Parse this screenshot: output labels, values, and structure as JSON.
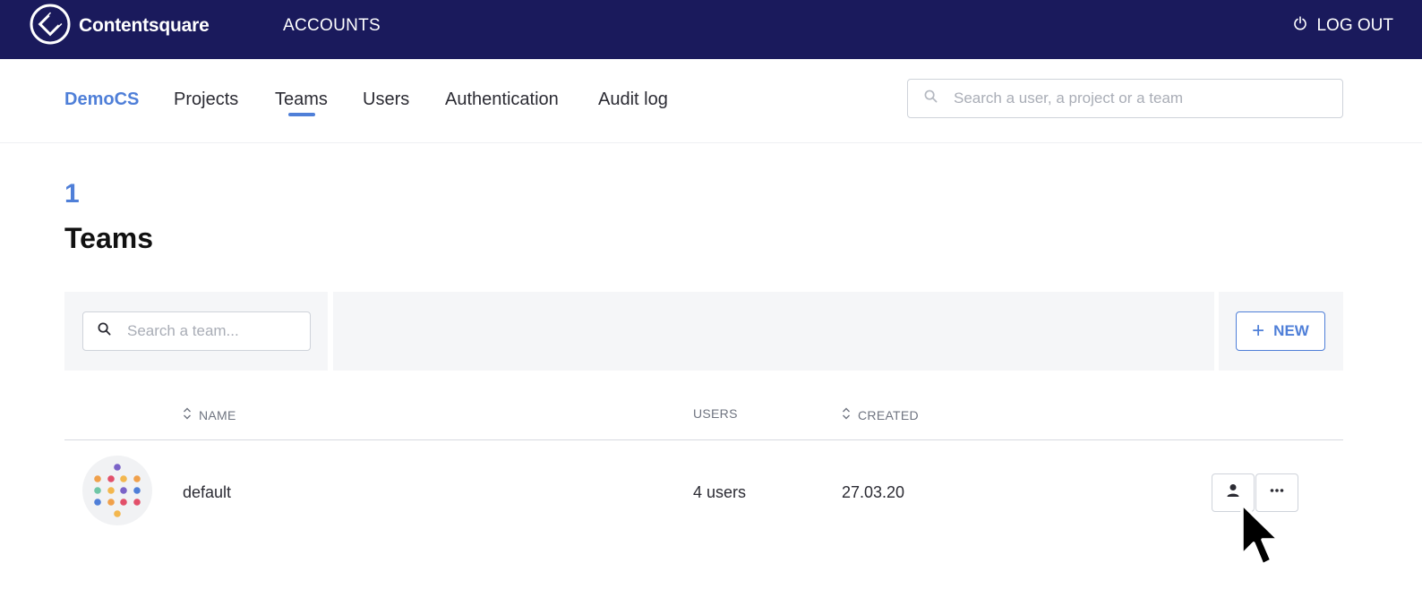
{
  "topbar": {
    "brand": "Contentsquare",
    "accounts": "ACCOUNTS",
    "logout": "LOG OUT"
  },
  "subnav": {
    "org": "DemoCS",
    "items": [
      "Projects",
      "Teams",
      "Users",
      "Authentication",
      "Audit log"
    ],
    "active": "Teams",
    "search_placeholder": "Search a user, a project or a team"
  },
  "page": {
    "count": "1",
    "title": "Teams"
  },
  "toolbar": {
    "search_placeholder": "Search a team...",
    "new_label": "NEW"
  },
  "table": {
    "columns": [
      "NAME",
      "USERS",
      "CREATED"
    ],
    "rows": [
      {
        "name": "default",
        "users": "4 users",
        "created": "27.03.20"
      }
    ]
  },
  "colors": {
    "topbar": "#1a1a5c",
    "accent": "#4f7fd8"
  }
}
